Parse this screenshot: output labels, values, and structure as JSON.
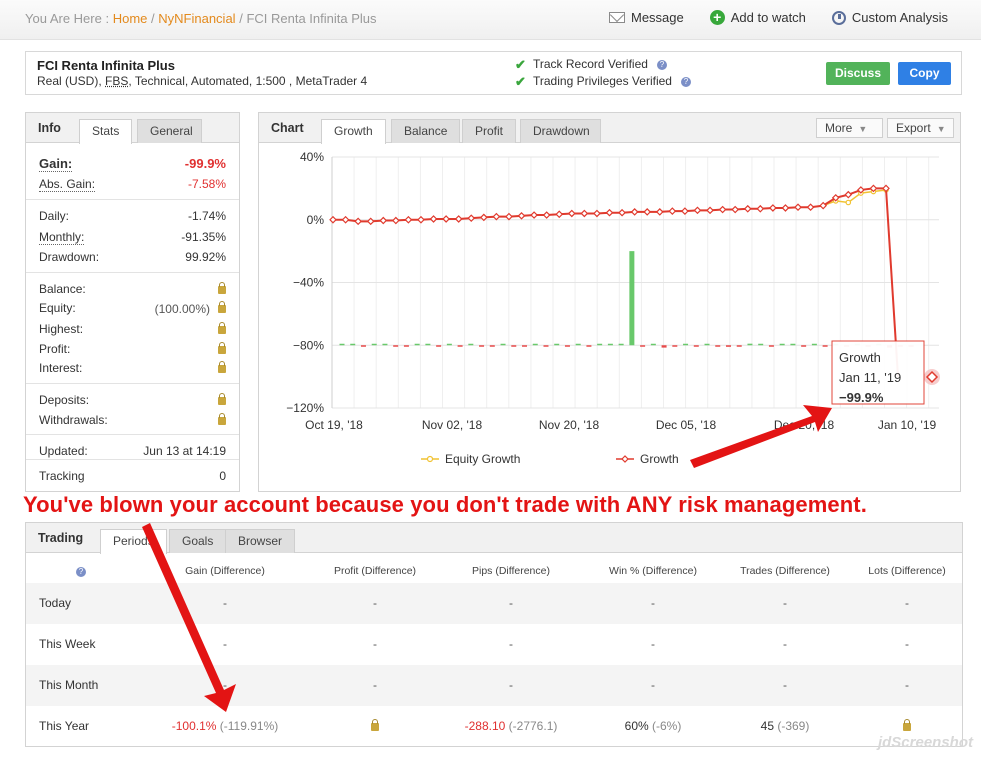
{
  "breadcrumb": {
    "prefix": "You Are Here :",
    "home": "Home",
    "sep1": "/",
    "section": "NyNFinancial",
    "sep2": "/",
    "current": "FCI Renta Infinita Plus"
  },
  "top_actions": {
    "message": "Message",
    "add_to_watch": "Add to watch",
    "custom_analysis": "Custom Analysis"
  },
  "account": {
    "name": "FCI Renta Infinita Plus",
    "desc_prefix": "Real (USD),",
    "broker": "FBS",
    "desc_suffix": ", Technical, Automated, 1:500 , MetaTrader 4",
    "track_record": "Track Record Verified",
    "trading_privileges": "Trading Privileges Verified",
    "discuss": "Discuss",
    "copy": "Copy"
  },
  "info_panel": {
    "title": "Info",
    "tabs": [
      "Stats",
      "General"
    ],
    "gain_label": "Gain:",
    "gain_value": "-99.9%",
    "abs_gain_label": "Abs. Gain:",
    "abs_gain_value": "-7.58%",
    "daily_label": "Daily:",
    "daily_value": "-1.74%",
    "monthly_label": "Monthly:",
    "monthly_value": "-91.35%",
    "drawdown_label": "Drawdown:",
    "drawdown_value": "99.92%",
    "balance_label": "Balance:",
    "equity_label": "Equity:",
    "equity_pct": "(100.00%)",
    "highest_label": "Highest:",
    "profit_label": "Profit:",
    "interest_label": "Interest:",
    "deposits_label": "Deposits:",
    "withdrawals_label": "Withdrawals:",
    "updated_label": "Updated:",
    "updated_value": "Jun 13 at 14:19",
    "tracking_label": "Tracking",
    "tracking_value": "0"
  },
  "chart_panel": {
    "title": "Chart",
    "tabs": [
      "Growth",
      "Balance",
      "Profit",
      "Drawdown"
    ],
    "more": "More",
    "export": "Export",
    "tooltip": {
      "series": "Growth",
      "date": "Jan 11, '19",
      "value": "−99.9%"
    }
  },
  "chart_data": {
    "type": "line",
    "yticks": [
      "40%",
      "0%",
      "−40%",
      "−80%",
      "−120%"
    ],
    "ylim": [
      -120,
      40
    ],
    "xticks": [
      "Oct 19, '18",
      "Nov 02, '18",
      "Nov 20, '18",
      "Dec 05, '18",
      "Dec 20, '18",
      "Jan 10, '19"
    ],
    "legend": [
      "Equity Growth",
      "Growth"
    ],
    "series": [
      {
        "name": "Growth",
        "values": [
          0,
          0,
          -1,
          -1,
          -0.5,
          -0.5,
          0,
          0,
          0.5,
          0.5,
          0.5,
          1,
          1.5,
          2,
          2,
          2.5,
          3,
          3,
          3.5,
          4,
          4,
          4,
          4.5,
          4.5,
          5,
          5,
          5,
          5.5,
          5.5,
          6,
          6,
          6.5,
          6.5,
          7,
          7,
          7.5,
          7.5,
          8,
          8,
          9,
          14,
          16,
          19,
          20,
          20,
          -99.9
        ]
      },
      {
        "name": "Equity Growth",
        "values": [
          0,
          0,
          -1,
          -1,
          -0.5,
          -0.5,
          0,
          0,
          0.5,
          0.5,
          0.5,
          1,
          1.5,
          2,
          2,
          2.5,
          3,
          3,
          3.5,
          4,
          4,
          4,
          4.5,
          4.5,
          5,
          5,
          5,
          5.5,
          5.5,
          6,
          6,
          6.5,
          6.5,
          7,
          7,
          7.5,
          7.5,
          8,
          8,
          9,
          12,
          11,
          17,
          18,
          19,
          -99.9
        ]
      }
    ],
    "bars": {
      "baseline": -80,
      "values": [
        0,
        0,
        -0.5,
        0,
        0.4,
        -0.3,
        -0.6,
        0.3,
        0,
        -0.5,
        0.3,
        -0.4,
        0,
        -0.6,
        -0.7,
        0.3,
        -0.5,
        -0.4,
        0.5,
        -0.3,
        0,
        -0.6,
        0.4,
        -0.5,
        0.6,
        0.3,
        0.5,
        60,
        -0.4,
        0.3,
        -1.5,
        -0.5,
        0,
        -0.6,
        0.3,
        -0.7,
        -1,
        -0.5,
        1,
        0.4,
        -0.4,
        0.3,
        0.4,
        -0.6,
        0.5,
        -0.5,
        0.6,
        -0.3,
        0.5,
        -0.4,
        0,
        -1.5,
        -0.5,
        -1
      ]
    },
    "title": "",
    "xlabel": "",
    "ylabel": ""
  },
  "warning_text": "You've blown your account because you don't trade with ANY risk management.",
  "trading_panel": {
    "title": "Trading",
    "tabs": [
      "Periods",
      "Goals",
      "Browser"
    ],
    "columns": [
      "Gain (Difference)",
      "Profit (Difference)",
      "Pips (Difference)",
      "Win % (Difference)",
      "Trades (Difference)",
      "Lots (Difference)"
    ],
    "rows": [
      {
        "label": "Today",
        "gain": "-",
        "profit": "-",
        "pips": "-",
        "win": "-",
        "trades": "-",
        "lots": "-"
      },
      {
        "label": "This Week",
        "gain": "-",
        "profit": "-",
        "pips": "-",
        "win": "-",
        "trades": "-",
        "lots": "-"
      },
      {
        "label": "This Month",
        "gain": "-",
        "profit": "-",
        "pips": "-",
        "win": "-",
        "trades": "-",
        "lots": "-"
      },
      {
        "label": "This Year",
        "gain": "-100.1%",
        "gain_diff": "(-119.91%)",
        "pips": "-288.10",
        "pips_diff": "(-2776.1)",
        "win": "60%",
        "win_diff": "(-6%)",
        "trades": "45",
        "trades_diff": "(-369)"
      }
    ]
  },
  "watermark": "jdScreenshot",
  "colors": {
    "growth": "#e03a2e",
    "equity": "#f1c232",
    "bar_positive": "#69c96b",
    "bar_negative": "#e84a4a",
    "annotation": "#e31414"
  }
}
